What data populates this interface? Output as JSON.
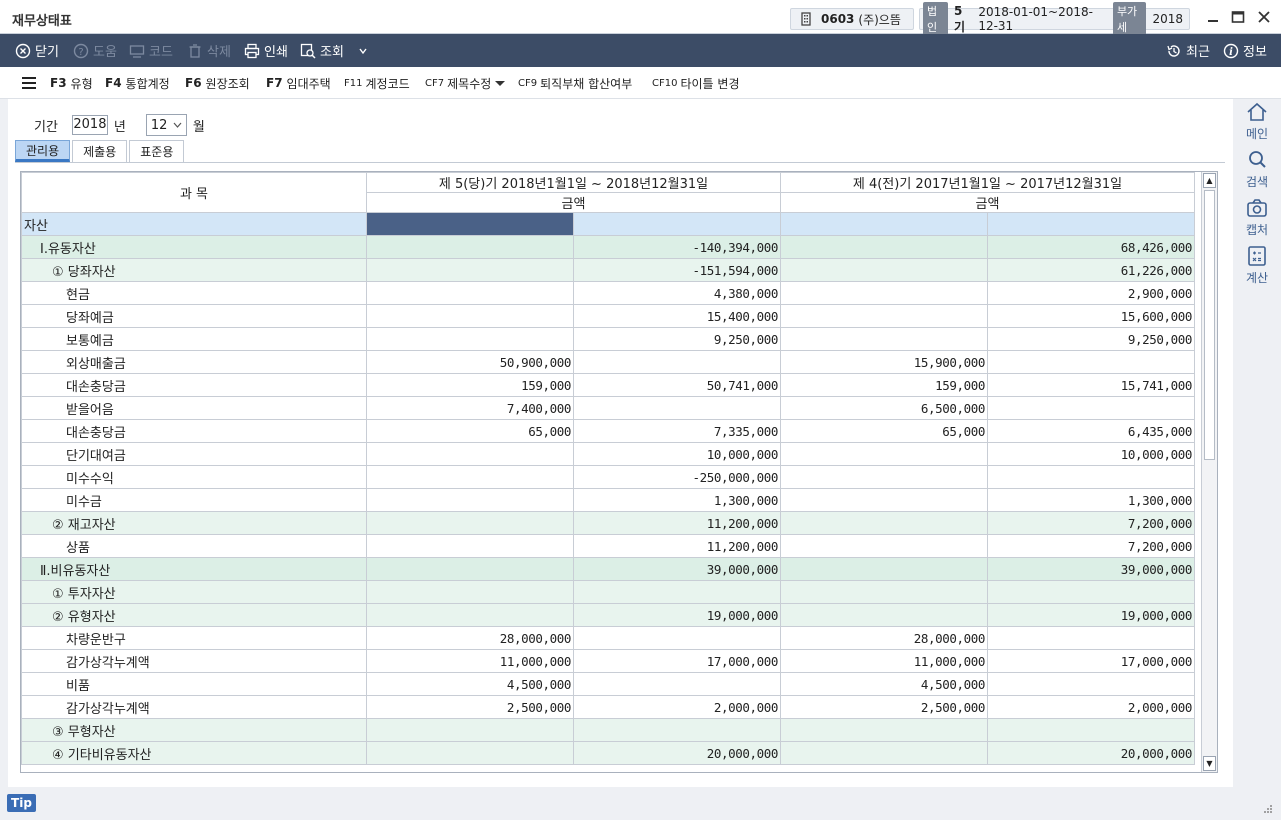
{
  "window": {
    "title": "재무상태표",
    "company_code": "0603",
    "company_name": "(주)으뜸",
    "corp_tag": "법인",
    "term": "5기",
    "period_range": "2018-01-01~2018-12-31",
    "vat_tag": "부가세",
    "vat_year": "2018"
  },
  "toolbar": {
    "close": "닫기",
    "help": "도움",
    "code": "코드",
    "delete": "삭제",
    "print": "인쇄",
    "inquiry": "조회",
    "recent": "최근",
    "info": "정보"
  },
  "fbar": {
    "f3_key": "F3",
    "f3_label": "유형",
    "f4_key": "F4",
    "f4_label": "통합계정",
    "f6_key": "F6",
    "f6_label": "원장조회",
    "f7_key": "F7",
    "f7_label": "임대주택",
    "f11_key": "F11",
    "f11_label": "계정코드",
    "cf7_key": "CF7",
    "cf7_label": "제목수정",
    "cf9_key": "CF9",
    "cf9_label": "퇴직부채 합산여부",
    "cf10_key": "CF10",
    "cf10_label": "타이틀 변경"
  },
  "filter": {
    "period_label": "기간",
    "year": "2018",
    "year_unit": "년",
    "month": "12",
    "month_unit": "월"
  },
  "tabs": [
    "관리용",
    "제출용",
    "표준용"
  ],
  "grid": {
    "col_subject": "과       목",
    "col_current": "제 5(당)기 2018년1월1일 ~ 2018년12월31일",
    "col_prior": "제 4(전)기 2017년1월1일 ~ 2017년12월31일",
    "amount_label": "금액",
    "rows": [
      {
        "type": "sec",
        "name": "자산",
        "c1": "",
        "c2": "",
        "p1": "",
        "p2": ""
      },
      {
        "type": "grp",
        "name": "Ⅰ.유동자산",
        "c1": "",
        "c2": "-140,394,000",
        "p1": "",
        "p2": "68,426,000"
      },
      {
        "type": "sub",
        "name": "① 당좌자산",
        "c1": "",
        "c2": "-151,594,000",
        "p1": "",
        "p2": "61,226,000"
      },
      {
        "type": "row",
        "name": "현금",
        "c1": "",
        "c2": "4,380,000",
        "p1": "",
        "p2": "2,900,000"
      },
      {
        "type": "row",
        "name": "당좌예금",
        "c1": "",
        "c2": "15,400,000",
        "p1": "",
        "p2": "15,600,000"
      },
      {
        "type": "row",
        "name": "보통예금",
        "c1": "",
        "c2": "9,250,000",
        "p1": "",
        "p2": "9,250,000"
      },
      {
        "type": "row",
        "name": "외상매출금",
        "c1": "50,900,000",
        "c2": "",
        "p1": "15,900,000",
        "p2": ""
      },
      {
        "type": "row",
        "name": "대손충당금",
        "c1": "159,000",
        "c2": "50,741,000",
        "p1": "159,000",
        "p2": "15,741,000"
      },
      {
        "type": "row",
        "name": "받을어음",
        "c1": "7,400,000",
        "c2": "",
        "p1": "6,500,000",
        "p2": ""
      },
      {
        "type": "row",
        "name": "대손충당금",
        "c1": "65,000",
        "c2": "7,335,000",
        "p1": "65,000",
        "p2": "6,435,000"
      },
      {
        "type": "row",
        "name": "단기대여금",
        "c1": "",
        "c2": "10,000,000",
        "p1": "",
        "p2": "10,000,000"
      },
      {
        "type": "row",
        "name": "미수수익",
        "c1": "",
        "c2": "-250,000,000",
        "p1": "",
        "p2": ""
      },
      {
        "type": "row",
        "name": "미수금",
        "c1": "",
        "c2": "1,300,000",
        "p1": "",
        "p2": "1,300,000"
      },
      {
        "type": "sub",
        "name": "② 재고자산",
        "c1": "",
        "c2": "11,200,000",
        "p1": "",
        "p2": "7,200,000"
      },
      {
        "type": "row",
        "name": "상품",
        "c1": "",
        "c2": "11,200,000",
        "p1": "",
        "p2": "7,200,000"
      },
      {
        "type": "grp",
        "name": "Ⅱ.비유동자산",
        "c1": "",
        "c2": "39,000,000",
        "p1": "",
        "p2": "39,000,000"
      },
      {
        "type": "sub",
        "name": "① 투자자산",
        "c1": "",
        "c2": "",
        "p1": "",
        "p2": ""
      },
      {
        "type": "sub",
        "name": "② 유형자산",
        "c1": "",
        "c2": "19,000,000",
        "p1": "",
        "p2": "19,000,000"
      },
      {
        "type": "row",
        "name": "차량운반구",
        "c1": "28,000,000",
        "c2": "",
        "p1": "28,000,000",
        "p2": ""
      },
      {
        "type": "row",
        "name": "감가상각누계액",
        "c1": "11,000,000",
        "c2": "17,000,000",
        "p1": "11,000,000",
        "p2": "17,000,000"
      },
      {
        "type": "row",
        "name": "비품",
        "c1": "4,500,000",
        "c2": "",
        "p1": "4,500,000",
        "p2": ""
      },
      {
        "type": "row",
        "name": "감가상각누계액",
        "c1": "2,500,000",
        "c2": "2,000,000",
        "p1": "2,500,000",
        "p2": "2,000,000"
      },
      {
        "type": "sub",
        "name": "③ 무형자산",
        "c1": "",
        "c2": "",
        "p1": "",
        "p2": ""
      },
      {
        "type": "sub",
        "name": "④ 기타비유동자산",
        "c1": "",
        "c2": "20,000,000",
        "p1": "",
        "p2": "20,000,000"
      }
    ]
  },
  "rail": {
    "main": "메인",
    "search": "검색",
    "capture": "캡처",
    "calc": "계산"
  },
  "status": {
    "tip": "Tip"
  }
}
